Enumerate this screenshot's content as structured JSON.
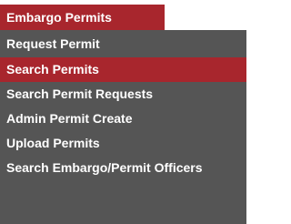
{
  "menu": {
    "header": "Embargo Permits",
    "items": [
      {
        "label": "Request Permit"
      },
      {
        "label": "Search Permits"
      },
      {
        "label": "Search Permit Requests"
      },
      {
        "label": "Admin Permit Create"
      },
      {
        "label": "Upload Permits"
      },
      {
        "label": "Search Embargo/Permit Officers"
      }
    ],
    "selected_label": "Search Permits"
  },
  "colors": {
    "header_bg": "#a8262d",
    "menu_bg": "#555555",
    "selected_bg": "#a8262d",
    "text": "#ffffff"
  }
}
